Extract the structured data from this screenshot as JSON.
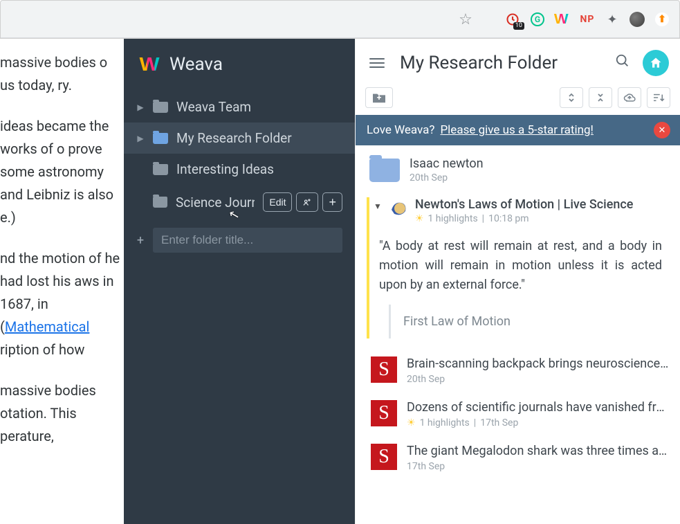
{
  "browser": {
    "extBadge": "10",
    "npLabel": "NP"
  },
  "article": {
    "p1": "massive bodies o us today, ry.",
    "p2_a": "ideas became  the works of o prove some astronomy and Leibniz is also e.)",
    "p3_a": "nd the motion of  he had lost his aws in 1687, in (",
    "p3_link": "Mathematical",
    "p3_b": " ription of how",
    "p4": " massive bodies otation. This perature,"
  },
  "sidebar": {
    "brand": "Weava",
    "items": [
      {
        "label": "Weava Team",
        "hasChevron": true,
        "colorClass": ""
      },
      {
        "label": "My Research Folder",
        "hasChevron": true,
        "colorClass": "blue",
        "active": true
      },
      {
        "label": "Interesting Ideas",
        "hasChevron": false,
        "colorClass": ""
      },
      {
        "label": "Science Journ",
        "hasChevron": false,
        "colorClass": ""
      }
    ],
    "editBtn": "Edit",
    "shareIcon": "⁺²",
    "addIcon": "+",
    "newFolderPlaceholder": "Enter folder title..."
  },
  "panel": {
    "title": "My Research Folder",
    "promo": {
      "prefix": "Love Weava? ",
      "link": "Please give us a 5-star rating!"
    },
    "subfolder": {
      "title": "Isaac newton",
      "date": "20th Sep"
    },
    "source1": {
      "title": "Newton's Laws of Motion | Live Science",
      "highlightsLabel": "1 highlights",
      "time": "10:18 pm",
      "quote": "\"A body at rest will remain at rest, and a body in motion will remain in motion unless it is acted upon by an external force.\"",
      "note": "First Law of Motion"
    },
    "sources": [
      {
        "title": "Brain-scanning backpack brings neuroscience ...",
        "date": "20th Sep",
        "highlights": null
      },
      {
        "title": "Dozens of scientific journals have vanished fro...",
        "date": "17th Sep",
        "highlights": "1 highlights"
      },
      {
        "title": "The giant Megalodon shark was three times as...",
        "date": "17th Sep",
        "highlights": null
      }
    ]
  }
}
